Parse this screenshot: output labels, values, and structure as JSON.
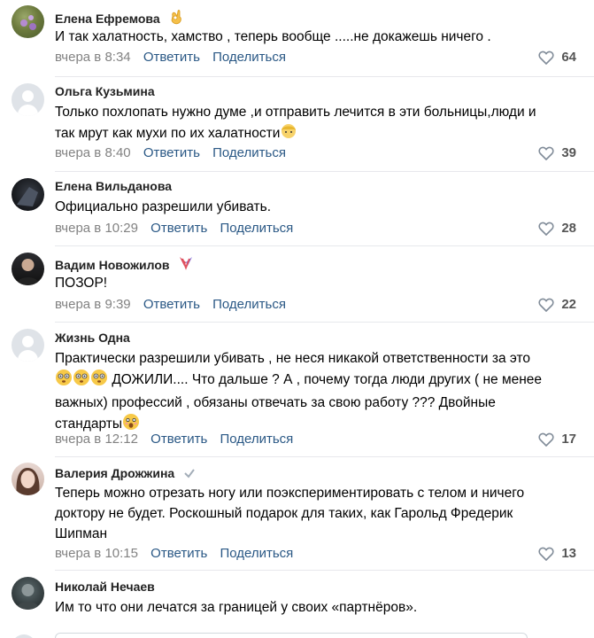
{
  "comments": [
    {
      "author": "Елена Ефремова",
      "text": "И так халатность, хамство , теперь вообще .....не докажешь ничего .",
      "time": "вчера в 8:34",
      "reply": "Ответить",
      "share": "Поделиться",
      "likes": "64",
      "badge_icon": "ok-hand-emoji-icon"
    },
    {
      "author": "Ольга Кузьмина",
      "text_line1": "Только похлопать нужно думе ,и отправить лечится в эти больницы,люди и",
      "text_line2": "так мрут как мухи по их халатности",
      "time": "вчера в 8:40",
      "reply": "Ответить",
      "share": "Поделиться",
      "likes": "39"
    },
    {
      "author": "Елена Вильданова",
      "text": "Официально разрешили убивать.",
      "time": "вчера в 10:29",
      "reply": "Ответить",
      "share": "Поделиться",
      "likes": "28"
    },
    {
      "author": "Вадим Новожилов",
      "text": "ПОЗОР!",
      "time": "вчера в 9:39",
      "reply": "Ответить",
      "share": "Поделиться",
      "likes": "22",
      "badge_icon": "ribbon-icon"
    },
    {
      "author": "Жизнь Одна",
      "text_line1": "Практически разрешили убивать , не неся никакой ответственности за это",
      "text_line2": "ДОЖИЛИ.... Что дальше ? А , почему тогда люди других ( не менее",
      "text_line3": "важных) профессий , обязаны отвечать за свою работу ??? Двойные",
      "text_line4": "стандарты",
      "time": "вчера в 12:12",
      "reply": "Ответить",
      "share": "Поделиться",
      "likes": "17"
    },
    {
      "author": "Валерия Дрожжина",
      "text_line1": "Теперь можно отрезать ногу или поэкспериментировать с телом и ничего",
      "text_line2": "доктору не будет. Роскошный подарок для таких, как Гарольд Фредерик",
      "text_line3": "Шипман",
      "time": "вчера в 10:15",
      "reply": "Ответить",
      "share": "Поделиться",
      "likes": "13",
      "badge_icon": "verified-check-icon"
    },
    {
      "author": "Николай Нечаев",
      "text": "Им то что они лечатся за границей у своих «партнёров»."
    }
  ],
  "colors": {
    "link": "#2a5885",
    "meta": "#828282",
    "separator": "#e7e8ec"
  }
}
